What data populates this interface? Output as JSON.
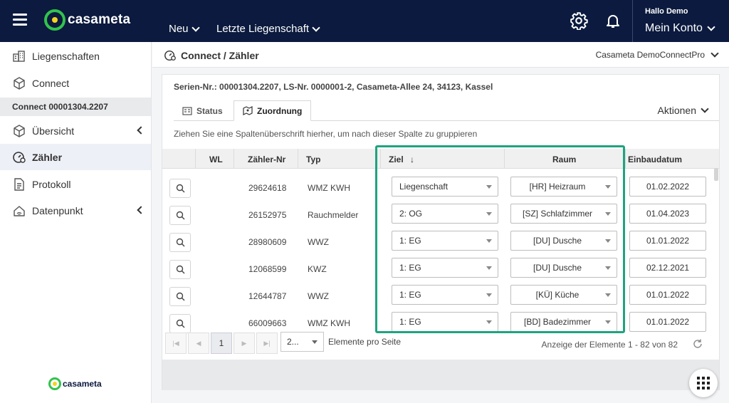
{
  "header": {
    "logo_text": "casameta",
    "nav_new": "Neu",
    "nav_last": "Letzte Liegenschaft",
    "greeting": "Hallo Demo",
    "account": "Mein Konto",
    "colors": {
      "bar": "#0b1a3e",
      "brand_green": "#33c24d",
      "brand_yellow": "#f4d21f"
    }
  },
  "sidebar": {
    "items": [
      {
        "label": "Liegenschaften",
        "icon": "buildings-icon"
      },
      {
        "label": "Connect",
        "icon": "box-icon"
      }
    ],
    "section": "Connect 00001304.2207",
    "sub_items": [
      {
        "label": "Übersicht",
        "icon": "box-icon"
      },
      {
        "label": "Zähler",
        "icon": "meter-icon"
      },
      {
        "label": "Protokoll",
        "icon": "document-icon"
      },
      {
        "label": "Datenpunkt",
        "icon": "wifi-house-icon"
      }
    ],
    "footer_logo": "casameta"
  },
  "subheader": {
    "title": "Connect / Zähler",
    "tenant": "Casameta DemoConnectPro"
  },
  "card": {
    "serial_line": "Serien-Nr.: 00001304.2207, LS-Nr. 0000001-2, Casameta-Allee 24, 34123, Kassel",
    "tabs": [
      "Status",
      "Zuordnung"
    ],
    "actions": "Aktionen",
    "grouping_hint": "Ziehen Sie eine Spaltenüberschrift hierher, um nach dieser Spalte zu gruppieren",
    "columns": {
      "wl": "WL",
      "nr": "Zähler-Nr",
      "typ": "Typ",
      "ziel": "Ziel",
      "sort": "↓",
      "raum": "Raum",
      "datum": "Einbaudatum"
    },
    "rows": [
      {
        "nr": "29624618",
        "typ": "WMZ KWH",
        "ziel": "Liegenschaft",
        "raum": "[HR] Heizraum",
        "datum": "01.02.2022"
      },
      {
        "nr": "26152975",
        "typ": "Rauchmelder",
        "ziel": "2: OG",
        "raum": "[SZ] Schlafzimmer",
        "datum": "01.04.2023"
      },
      {
        "nr": "28980609",
        "typ": "WWZ",
        "ziel": "1: EG",
        "raum": "[DU] Dusche",
        "datum": "01.01.2022"
      },
      {
        "nr": "12068599",
        "typ": "KWZ",
        "ziel": "1: EG",
        "raum": "[DU] Dusche",
        "datum": "02.12.2021"
      },
      {
        "nr": "12644787",
        "typ": "WWZ",
        "ziel": "1: EG",
        "raum": "[KÜ] Küche",
        "datum": "01.01.2022"
      },
      {
        "nr": "66009663",
        "typ": "WMZ KWH",
        "ziel": "1: EG",
        "raum": "[BD] Badezimmer",
        "datum": "01.01.2022"
      }
    ],
    "pager": {
      "current_page": "1",
      "page_size": "2...",
      "per_page_label": "Elemente pro Seite",
      "count": "Anzeige der Elemente 1 - 82 von 82"
    },
    "highlight_color": "#1fa37f"
  }
}
